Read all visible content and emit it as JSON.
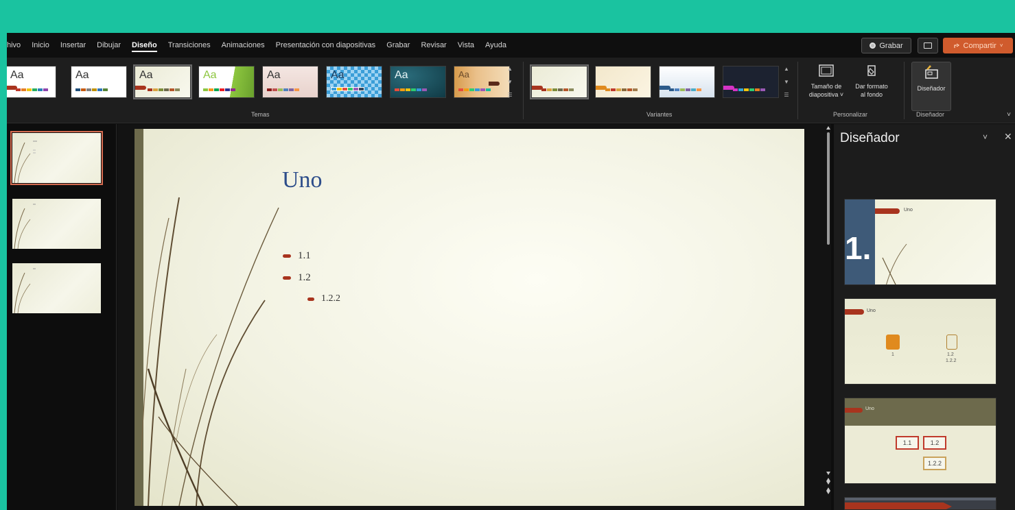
{
  "menu": {
    "tabs": [
      "hivo",
      "Inicio",
      "Insertar",
      "Dibujar",
      "Diseño",
      "Transiciones",
      "Animaciones",
      "Presentación con diapositivas",
      "Grabar",
      "Revisar",
      "Vista",
      "Ayuda"
    ],
    "active_tab": "Diseño"
  },
  "toolbar": {
    "record_label": "Grabar",
    "share_label": "Compartir"
  },
  "ribbon": {
    "themes_label": "Temas",
    "variants_label": "Variantes",
    "personalize_label": "Personalizar",
    "designer_group_label": "Diseñador",
    "theme_aa": "Aa",
    "slide_size_line1": "Tamaño de",
    "slide_size_line2": "diapositiva ˅",
    "format_bg_line1": "Dar formato",
    "format_bg_line2": "al fondo",
    "designer_label": "Diseñador"
  },
  "slide": {
    "title": "Uno",
    "bullets": [
      {
        "text": "1.1",
        "level": 1
      },
      {
        "text": "1.2",
        "level": 1
      },
      {
        "text": "1.2.2",
        "level": 2
      }
    ]
  },
  "designer_pane": {
    "title": "Diseñador",
    "option1_number": "1.",
    "option1_title": "Uno",
    "option2_title": "Uno",
    "option2_item1": "1",
    "option2_item2": "1.2",
    "option2_item2b": "1.2.2",
    "option3_title": "Uno",
    "option3_box1": "1.1",
    "option3_box2": "1.2",
    "option3_box3": "1.2.2"
  },
  "colors": {
    "accent_teal": "#1ac3a0",
    "share_orange": "#d05b2d",
    "theme_red": "#a8341e",
    "title_blue": "#2d4d8a"
  }
}
